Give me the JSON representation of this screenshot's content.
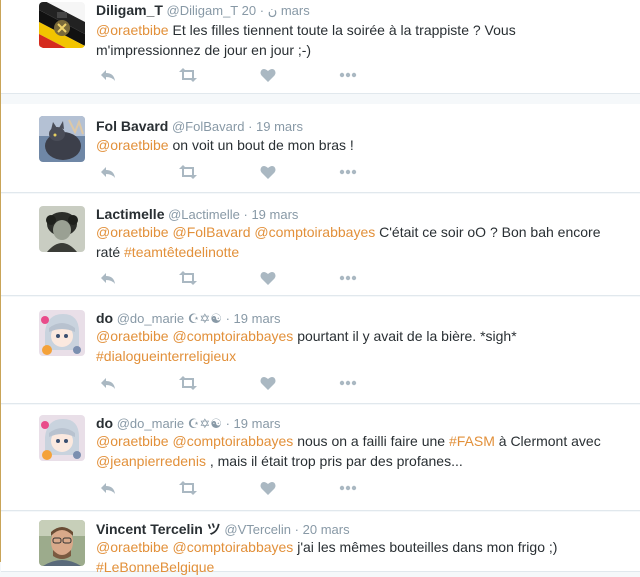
{
  "colors": {
    "link": "#e2903a",
    "muted": "#8899a6",
    "icon": "#aab8c2",
    "name": "#292f33"
  },
  "tweets": [
    {
      "name": "Diligam_T",
      "handle": "@Diligam_T ن",
      "time": "20 mars",
      "avatar": "belgian-flag-coat-of-arms",
      "body": [
        {
          "t": "link",
          "v": "@oraetbibe"
        },
        {
          "t": "text",
          "v": " Et les filles tiennent toute la soirée à la trappiste ? Vous m'impressionnez de jour en jour ;-)"
        }
      ]
    },
    {
      "name": "Fol Bavard",
      "handle": "@FolBavard",
      "time": "19 mars",
      "avatar": "cat-photo",
      "body": [
        {
          "t": "link",
          "v": "@oraetbibe"
        },
        {
          "t": "text",
          "v": "  on voit un bout de mon bras !"
        }
      ]
    },
    {
      "name": "Lactimelle",
      "handle": "@Lactimelle",
      "time": "19 mars",
      "avatar": "vintage-portrait",
      "body": [
        {
          "t": "link",
          "v": "@oraetbibe"
        },
        {
          "t": "text",
          "v": " "
        },
        {
          "t": "link",
          "v": "@FolBavard"
        },
        {
          "t": "text",
          "v": " "
        },
        {
          "t": "link",
          "v": "@comptoirabbayes"
        },
        {
          "t": "text",
          "v": " C'était ce soir oO ? Bon bah encore raté "
        },
        {
          "t": "link",
          "v": "#teamtêtedelinotte"
        }
      ]
    },
    {
      "name": "do",
      "handle": "@do_marie ☪✡☯",
      "time": "19 mars",
      "avatar": "anime-character",
      "body": [
        {
          "t": "link",
          "v": "@oraetbibe"
        },
        {
          "t": "text",
          "v": " "
        },
        {
          "t": "link",
          "v": "@comptoirabbayes"
        },
        {
          "t": "text",
          "v": " pourtant il y avait de la bière. *sigh* "
        },
        {
          "t": "link",
          "v": "#dialogueinterreligieux"
        }
      ]
    },
    {
      "name": "do",
      "handle": "@do_marie ☪✡☯",
      "time": "19 mars",
      "avatar": "anime-character",
      "body": [
        {
          "t": "link",
          "v": "@oraetbibe"
        },
        {
          "t": "text",
          "v": " "
        },
        {
          "t": "link",
          "v": "@comptoirabbayes"
        },
        {
          "t": "text",
          "v": " nous on a failli  faire une "
        },
        {
          "t": "link",
          "v": "#FASM"
        },
        {
          "t": "text",
          "v": " à Clermont avec "
        },
        {
          "t": "link",
          "v": "@jeanpierredenis"
        },
        {
          "t": "text",
          "v": " , mais il était trop pris par des profanes..."
        }
      ]
    },
    {
      "name": "Vincent Tercelin ツ",
      "handle": "@VTercelin",
      "time": "20 mars",
      "avatar": "man-portrait",
      "body": [
        {
          "t": "link",
          "v": "@oraetbibe"
        },
        {
          "t": "text",
          "v": " "
        },
        {
          "t": "link",
          "v": "@comptoirabbayes"
        },
        {
          "t": "text",
          "v": " j'ai les mêmes bouteilles dans mon frigo ;) "
        },
        {
          "t": "link",
          "v": "#LeBonneBelgique"
        }
      ]
    }
  ],
  "action_icons": [
    "reply-icon",
    "retweet-icon",
    "like-icon",
    "more-icon"
  ],
  "separator": "·"
}
